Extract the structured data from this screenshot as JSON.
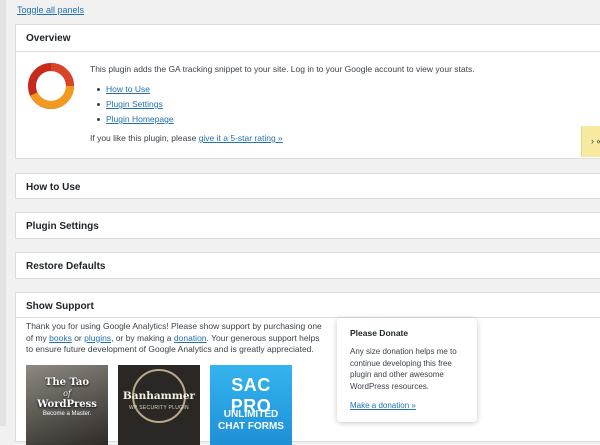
{
  "toggle_all": "Toggle all panels",
  "overview": {
    "title": "Overview",
    "description": "This plugin adds the GA tracking snippet to your site. Log in to your Google account to view your stats.",
    "links": [
      "How to Use",
      "Plugin Settings",
      "Plugin Homepage"
    ],
    "rating_prefix": "If you like this plugin, please ",
    "rating_link": "give it a 5-star rating »",
    "side_tab": "› «"
  },
  "panels": {
    "how_to_use": "How to Use",
    "plugin_settings": "Plugin Settings",
    "restore_defaults": "Restore Defaults"
  },
  "show_support": {
    "title": "Show Support",
    "text_1": "Thank you for using Google Analytics! Please show support by purchasing one of my ",
    "books": "books",
    "or": " or ",
    "plugins": "plugins",
    "text_2": ", or by making a ",
    "donation": "donation",
    "text_3": ". Your generous support helps to ensure future development of Google Analytics and is greatly appreciated.",
    "thumbs": {
      "tao_line1": "The Tao",
      "tao_line2": "of",
      "tao_line3": "WordPress",
      "tao_line4": "Become a Master.",
      "ban_line1": "Banhammer",
      "ban_line2": "WP SECURITY PLUGIN",
      "sac_line1": "SAC PRO",
      "sac_line2": "UNLIMITED",
      "sac_line3": "CHAT FORMS"
    }
  },
  "donate": {
    "title": "Please Donate",
    "body": "Any size donation helps me to continue developing this free plugin and other awesome WordPress resources.",
    "link": "Make a donation »"
  }
}
